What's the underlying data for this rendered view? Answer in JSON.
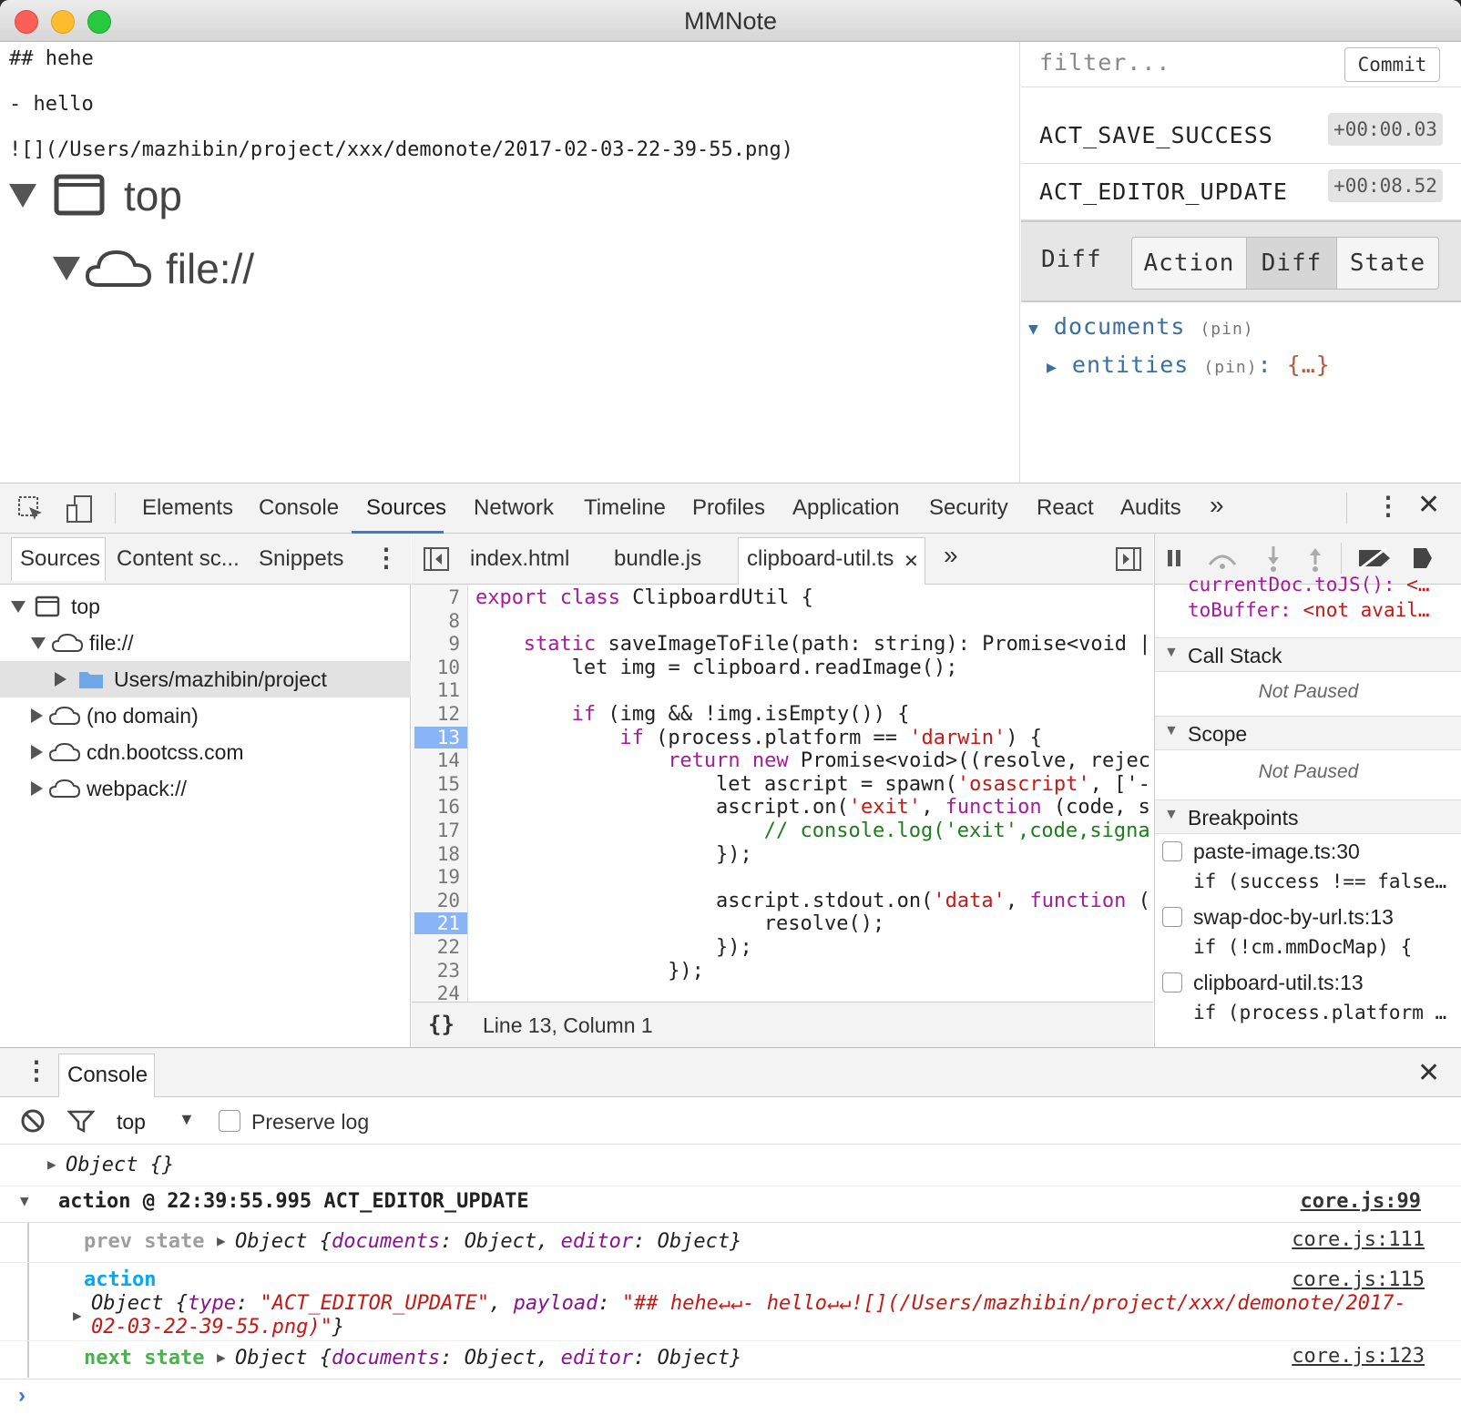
{
  "window": {
    "title": "MMNote"
  },
  "editor": {
    "lines": [
      "## hehe",
      "- hello",
      "![](/Users/mazhibin/project/xxx/demonote/2017-02-03-22-39-55.png)"
    ],
    "tree_top": "top",
    "tree_file": "file://"
  },
  "redux": {
    "filter_placeholder": "filter...",
    "commit_label": "Commit",
    "actions": [
      {
        "name": "ACT_SAVE_SUCCESS",
        "time": "+00:00.03"
      },
      {
        "name": "ACT_EDITOR_UPDATE",
        "time": "+00:08.52"
      }
    ],
    "panel_title": "Diff",
    "tabs": [
      "Action",
      "Diff",
      "State"
    ],
    "selected_tab": "Diff",
    "tree": {
      "documents": "documents",
      "entities": "entities",
      "pin": "(pin)",
      "entities_value": "{…}"
    }
  },
  "devtools": {
    "tabs": [
      "Elements",
      "Console",
      "Sources",
      "Network",
      "Timeline",
      "Profiles",
      "Application",
      "Security",
      "React",
      "Audits"
    ],
    "active_tab": "Sources",
    "navigator": {
      "tabs": [
        "Sources",
        "Content sc...",
        "Snippets"
      ],
      "tree": [
        "top",
        "file://",
        "Users/mazhibin/project",
        "(no domain)",
        "cdn.bootcss.com",
        "webpack://"
      ]
    },
    "editor_tabs": [
      "index.html",
      "bundle.js",
      "clipboard-util.ts"
    ],
    "active_file": "clipboard-util.ts",
    "status": "Line 13, Column 1",
    "line_numbers": [
      "7",
      "8",
      "9",
      "10",
      "11",
      "12",
      "13",
      "14",
      "15",
      "16",
      "17",
      "18",
      "19",
      "20",
      "21",
      "22",
      "23",
      "24"
    ],
    "breakpoint_lines": [
      "13",
      "21"
    ],
    "code": {
      "l7a": "export class ",
      "l7b": "ClipboardUtil {",
      "l9a": "static ",
      "l9b": "saveImageToFile(path: string): Promise<void |",
      "l10": "let img = clipboard.readImage();",
      "l12a": "if ",
      "l12b": "(img && !img.isEmpty()) {",
      "l13a": "if ",
      "l13b": "(process.platform == ",
      "l13c": "'darwin'",
      "l13d": ") {",
      "l14a": "return new ",
      "l14b": "Promise<void>((resolve, rejec",
      "l15a": "let ascript = spawn(",
      "l15b": "'osascript'",
      "l15c": ", ['-",
      "l16a": "ascript.on(",
      "l16b": "'exit'",
      "l16c": ", ",
      "l16d": "function ",
      "l16e": "(code, s",
      "l17": "// console.log('exit',code,signa",
      "l18": "});",
      "l20a": "ascript.stdout.on(",
      "l20b": "'data'",
      "l20c": ", ",
      "l20d": "function ",
      "l20e": "(",
      "l21": "resolve();",
      "l22": "});",
      "l23": "});"
    },
    "sidebar": {
      "watch1_name": "currentDoc.toJS():",
      "watch1_val": "<…",
      "watch2_name": "toBuffer:",
      "watch2_val": "<not avail…",
      "call_stack": "Call Stack",
      "scope": "Scope",
      "not_paused": "Not Paused",
      "breakpoints": "Breakpoints",
      "bp": [
        {
          "file": "paste-image.ts:30",
          "code": "if (success !== false…"
        },
        {
          "file": "swap-doc-by-url.ts:13",
          "code": "if (!cm.mmDocMap) {"
        },
        {
          "file": "clipboard-util.ts:13",
          "code": "if (process.platform …"
        }
      ]
    }
  },
  "console": {
    "tab": "Console",
    "context": "top",
    "preserve_log": "Preserve log",
    "obj_empty": "Object {}",
    "group_header": "action @ 22:39:55.995 ACT_EDITOR_UPDATE",
    "group_src": "core.js:99",
    "prev_label": "prev state",
    "prev_src": "core.js:111",
    "action_label": "action",
    "action_src": "core.js:115",
    "next_label": "next state",
    "next_src": "core.js:123",
    "obj_prefix": "Object {",
    "k_documents": "documents",
    "k_editor": "editor",
    "v_object": "Object",
    "k_type": "type",
    "v_type": "\"ACT_EDITOR_UPDATE\"",
    "k_payload": "payload",
    "v_payload1": "\"## hehe↵↵- hello↵↵![](/Users/mazhibin/project/xxx/demonote/2017-",
    "v_payload2": "02-03-22-39-55.png)\"",
    "obj_suffix": "}"
  },
  "colors": {
    "accent": "#3879d9",
    "breakpoint": "#8ab4f8",
    "keyword": "#a61b98",
    "string": "#c41a16",
    "comment": "#1e7b1e",
    "prev": "#9e9e9e",
    "action": "#03a9f4",
    "next": "#4caf50"
  }
}
